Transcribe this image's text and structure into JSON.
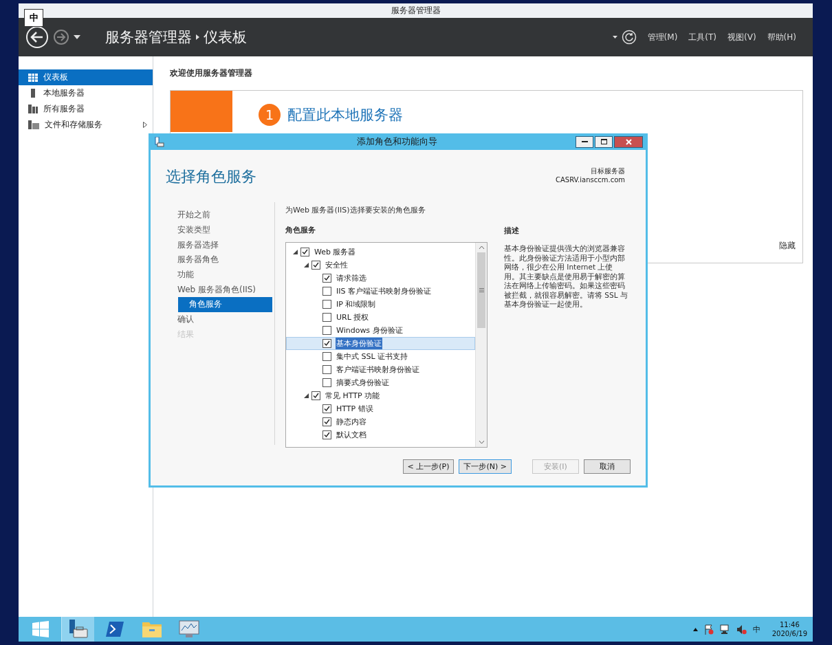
{
  "app_window": {
    "title": "服务器管理器",
    "ime_indicator": "中"
  },
  "header": {
    "breadcrumb": [
      "服务器管理器",
      "仪表板"
    ],
    "menu": [
      "管理(M)",
      "工具(T)",
      "视图(V)",
      "帮助(H)"
    ]
  },
  "sidebar": {
    "items": [
      {
        "label": "仪表板",
        "kind": "dashboard",
        "selected": true,
        "expandable": false
      },
      {
        "label": "本地服务器",
        "kind": "server",
        "selected": false,
        "expandable": false
      },
      {
        "label": "所有服务器",
        "kind": "servers",
        "selected": false,
        "expandable": false
      },
      {
        "label": "文件和存储服务",
        "kind": "storage",
        "selected": false,
        "expandable": true
      }
    ]
  },
  "welcome": {
    "title": "欢迎使用服务器管理器",
    "step_number": "1",
    "step_title": "配置此本地服务器",
    "hide_link": "隐藏"
  },
  "wizard": {
    "title": "添加角色和功能向导",
    "heading": "选择角色服务",
    "target_label": "目标服务器",
    "target_server": "CASRV.iansccm.com",
    "steps": [
      {
        "label": "开始之前",
        "selected": false,
        "disabled": false,
        "sub": false
      },
      {
        "label": "安装类型",
        "selected": false,
        "disabled": false,
        "sub": false
      },
      {
        "label": "服务器选择",
        "selected": false,
        "disabled": false,
        "sub": false
      },
      {
        "label": "服务器角色",
        "selected": false,
        "disabled": false,
        "sub": false
      },
      {
        "label": "功能",
        "selected": false,
        "disabled": false,
        "sub": false
      },
      {
        "label": "Web 服务器角色(IIS)",
        "selected": false,
        "disabled": false,
        "sub": false
      },
      {
        "label": "角色服务",
        "selected": true,
        "disabled": false,
        "sub": true
      },
      {
        "label": "确认",
        "selected": false,
        "disabled": false,
        "sub": false
      },
      {
        "label": "结果",
        "selected": false,
        "disabled": true,
        "sub": false
      }
    ],
    "instruction": "为Web 服务器(IIS)选择要安装的角色服务",
    "list_label": "角色服务",
    "tree": [
      {
        "label": "Web 服务器",
        "checked": true,
        "selected": false,
        "expanded": true,
        "children": [
          {
            "label": "安全性",
            "checked": true,
            "selected": false,
            "expanded": true,
            "children": [
              {
                "label": "请求筛选",
                "checked": true,
                "selected": false
              },
              {
                "label": "IIS 客户端证书映射身份验证",
                "checked": false,
                "selected": false
              },
              {
                "label": "IP 和域限制",
                "checked": false,
                "selected": false
              },
              {
                "label": "URL 授权",
                "checked": false,
                "selected": false
              },
              {
                "label": "Windows 身份验证",
                "checked": false,
                "selected": false
              },
              {
                "label": "基本身份验证",
                "checked": true,
                "selected": true
              },
              {
                "label": "集中式 SSL 证书支持",
                "checked": false,
                "selected": false
              },
              {
                "label": "客户端证书映射身份验证",
                "checked": false,
                "selected": false
              },
              {
                "label": "摘要式身份验证",
                "checked": false,
                "selected": false
              }
            ]
          },
          {
            "label": "常见 HTTP 功能",
            "checked": true,
            "selected": false,
            "expanded": true,
            "children": [
              {
                "label": "HTTP 错误",
                "checked": true,
                "selected": false
              },
              {
                "label": "静态内容",
                "checked": true,
                "selected": false
              },
              {
                "label": "默认文档",
                "checked": true,
                "selected": false
              }
            ]
          }
        ]
      }
    ],
    "description_label": "描述",
    "description": "基本身份验证提供强大的浏览器兼容性。此身份验证方法适用于小型内部网络，很少在公用 Internet 上使用。其主要缺点是使用易于解密的算法在网络上传输密码。如果这些密码被拦截，就很容易解密。请将 SSL 与基本身份验证一起使用。",
    "buttons": [
      {
        "label": "< 上一步(P)",
        "focused": false,
        "disabled": false
      },
      {
        "label": "下一步(N) >",
        "focused": true,
        "disabled": false
      },
      {
        "label": "安装(I)",
        "focused": false,
        "disabled": true
      },
      {
        "label": "取消",
        "focused": false,
        "disabled": false
      }
    ]
  },
  "taskbar": {
    "apps": [
      {
        "kind": "server-manager",
        "selected": true
      },
      {
        "kind": "powershell",
        "selected": false
      },
      {
        "kind": "explorer",
        "selected": false
      },
      {
        "kind": "monitor",
        "selected": false
      }
    ],
    "ime": "中",
    "time": "11:46",
    "date": "2020/6/19"
  }
}
